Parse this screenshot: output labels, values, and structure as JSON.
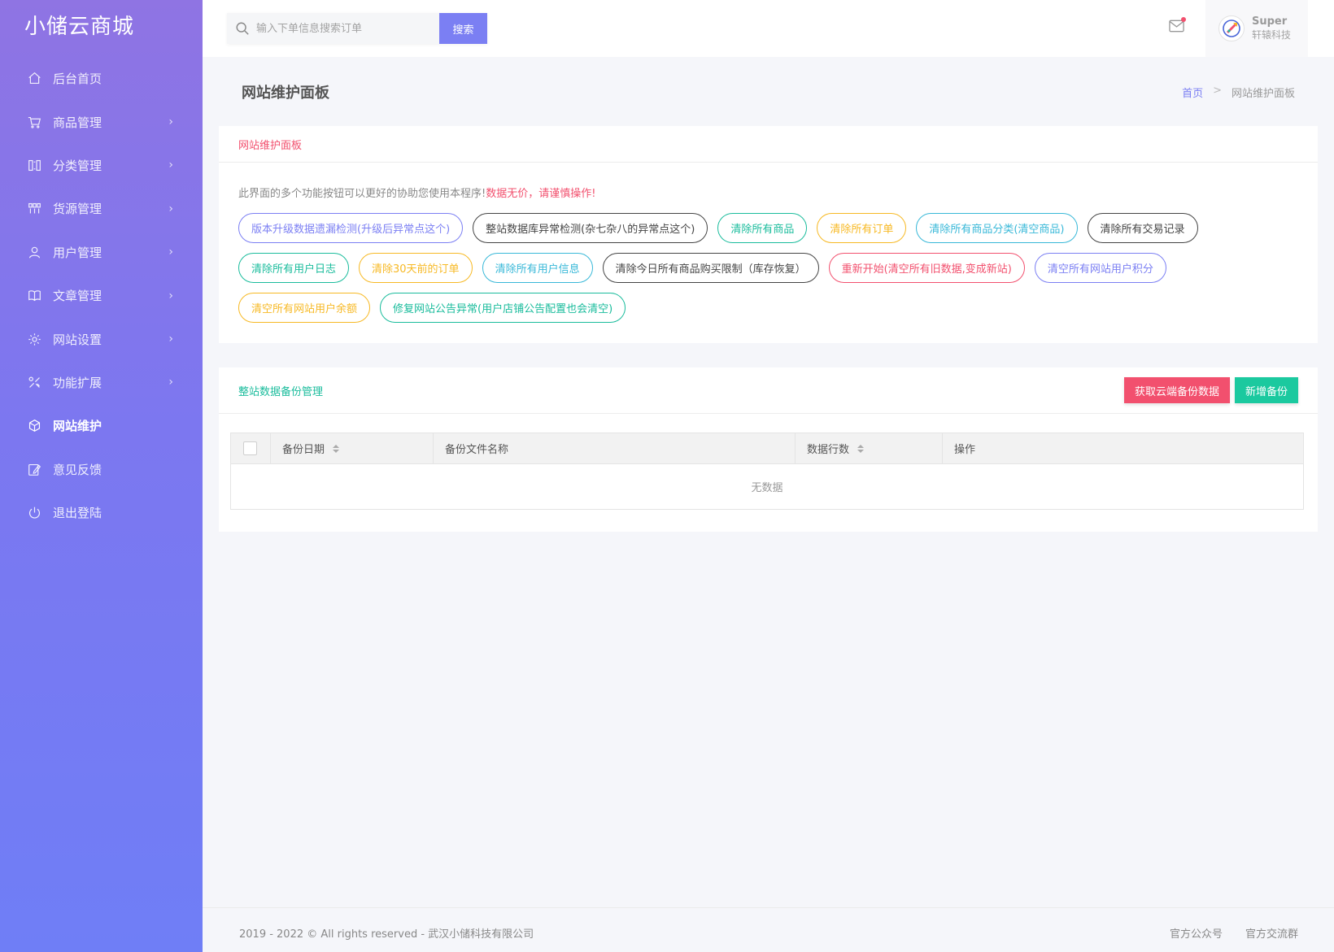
{
  "brand": "小储云商城",
  "sidebar": {
    "items": [
      {
        "label": "后台首页",
        "icon": "home-icon",
        "arrow": ""
      },
      {
        "label": "商品管理",
        "icon": "cart-icon",
        "arrow": "›"
      },
      {
        "label": "分类管理",
        "icon": "category-icon",
        "arrow": "›"
      },
      {
        "label": "货源管理",
        "icon": "source-icon",
        "arrow": "›"
      },
      {
        "label": "用户管理",
        "icon": "user-icon",
        "arrow": "›"
      },
      {
        "label": "文章管理",
        "icon": "book-icon",
        "arrow": "›"
      },
      {
        "label": "网站设置",
        "icon": "gear-icon",
        "arrow": "›"
      },
      {
        "label": "功能扩展",
        "icon": "tools-icon",
        "arrow": "›"
      },
      {
        "label": "网站维护",
        "icon": "cube-icon",
        "arrow": ""
      },
      {
        "label": "意见反馈",
        "icon": "edit-icon",
        "arrow": ""
      },
      {
        "label": "退出登陆",
        "icon": "power-icon",
        "arrow": ""
      }
    ],
    "active_index": 8
  },
  "header": {
    "search_placeholder": "输入下单信息搜索订单",
    "search_button": "搜索",
    "user_name": "Super",
    "user_company": "轩辕科技"
  },
  "page": {
    "title": "网站维护面板",
    "breadcrumb_home": "首页",
    "breadcrumb_sep": ">",
    "breadcrumb_current": "网站维护面板"
  },
  "panel": {
    "title": "网站维护面板",
    "notice": "此界面的多个功能按钮可以更好的协助您使用本程序!",
    "notice_warn": "数据无价，请谨慎操作!",
    "rows": [
      [
        {
          "label": "版本升级数据遗漏检测(升级后异常点这个)",
          "color": "c-blue"
        },
        {
          "label": "整站数据库异常检测(杂七杂八的异常点这个)",
          "color": "c-dark"
        },
        {
          "label": "清除所有商品",
          "color": "c-green"
        },
        {
          "label": "清除所有订单",
          "color": "c-orange"
        },
        {
          "label": "清除所有商品分类(清空商品)",
          "color": "c-cyan"
        },
        {
          "label": "清除所有交易记录",
          "color": "c-dark"
        }
      ],
      [
        {
          "label": "清除所有用户日志",
          "color": "c-green"
        },
        {
          "label": "清除30天前的订单",
          "color": "c-orange"
        },
        {
          "label": "清除所有用户信息",
          "color": "c-cyan"
        },
        {
          "label": "清除今日所有商品购买限制（库存恢复）",
          "color": "c-dark"
        },
        {
          "label": "重新开始(清空所有旧数据,变成新站)",
          "color": "c-red"
        },
        {
          "label": "清空所有网站用户积分",
          "color": "c-blue"
        }
      ],
      [
        {
          "label": "清空所有网站用户余额",
          "color": "c-orange"
        },
        {
          "label": "修复网站公告异常(用户店铺公告配置也会清空)",
          "color": "c-green"
        }
      ]
    ]
  },
  "backup": {
    "title": "整站数据备份管理",
    "btn_cloud": "获取云端备份数据",
    "btn_add": "新增备份",
    "columns": [
      "备份日期",
      "备份文件名称",
      "数据行数",
      "操作"
    ],
    "empty_text": "无数据"
  },
  "footer": {
    "copyright": "2019 - 2022 © All rights reserved - 武汉小储科技有限公司",
    "link1": "官方公众号",
    "link2": "官方交流群"
  },
  "colors": {
    "accent": "#7b7ff3",
    "danger": "#f2506e",
    "success": "#1abc9c",
    "warning": "#f7b924",
    "info": "#38b8d8"
  }
}
